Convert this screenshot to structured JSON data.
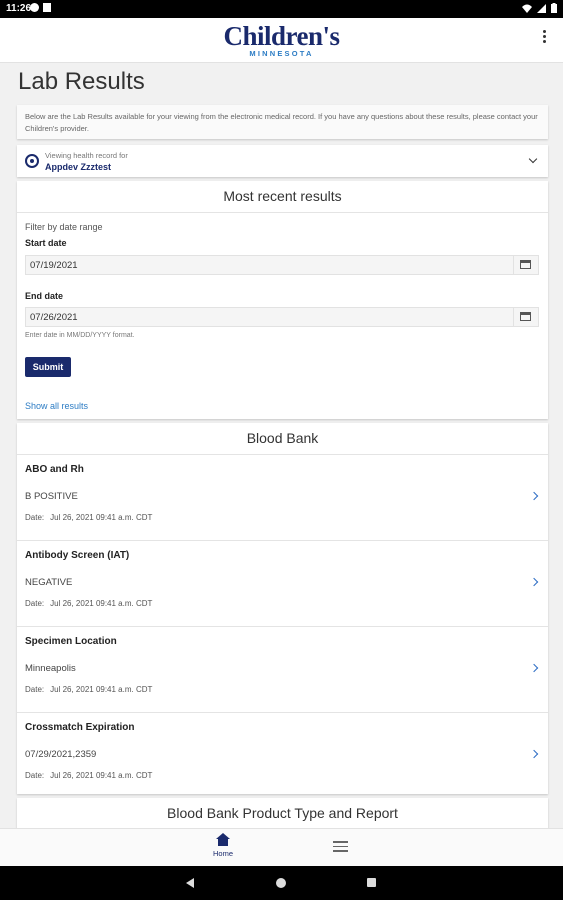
{
  "status": {
    "time": "11:26"
  },
  "app": {
    "logo_main": "Children's",
    "logo_sub": "MINNESOTA",
    "page_title": "Lab Results"
  },
  "intro": {
    "text": "Below are the Lab Results available for your viewing from the electronic medical record. If you have any questions about these results, please contact your Children's provider."
  },
  "record": {
    "label": "Viewing health record for",
    "name": "Appdev Zzztest"
  },
  "recent": {
    "title": "Most recent results",
    "filter_label": "Filter by date range",
    "start_label": "Start date",
    "start_value": "07/19/2021",
    "end_label": "End date",
    "end_value": "07/26/2021",
    "hint": "Enter date in MM/DD/YYYY format.",
    "submit": "Submit",
    "show_all": "Show all results"
  },
  "blood_bank": {
    "title": "Blood Bank",
    "date_prefix": "Date:",
    "results": [
      {
        "title": "ABO and Rh",
        "value": "B POSITIVE",
        "date": "Jul 26, 2021 09:41 a.m. CDT"
      },
      {
        "title": "Antibody Screen (IAT)",
        "value": "NEGATIVE",
        "date": "Jul 26, 2021 09:41 a.m. CDT"
      },
      {
        "title": "Specimen Location",
        "value": "Minneapolis",
        "date": "Jul 26, 2021 09:41 a.m. CDT"
      },
      {
        "title": "Crossmatch Expiration",
        "value": "07/29/2021,2359",
        "date": "Jul 26, 2021 09:41 a.m. CDT"
      }
    ]
  },
  "product": {
    "title": "Blood Bank Product Type and Report"
  },
  "bottom_nav": {
    "home_label": "Home"
  },
  "colors": {
    "brand_navy": "#1a2a6c",
    "accent_blue": "#2c7cc4"
  },
  "icons": [
    "record-icon",
    "chevron-down-icon",
    "calendar-icon",
    "chevron-right-icon",
    "home-icon",
    "menu-icon",
    "kebab-menu-icon"
  ]
}
